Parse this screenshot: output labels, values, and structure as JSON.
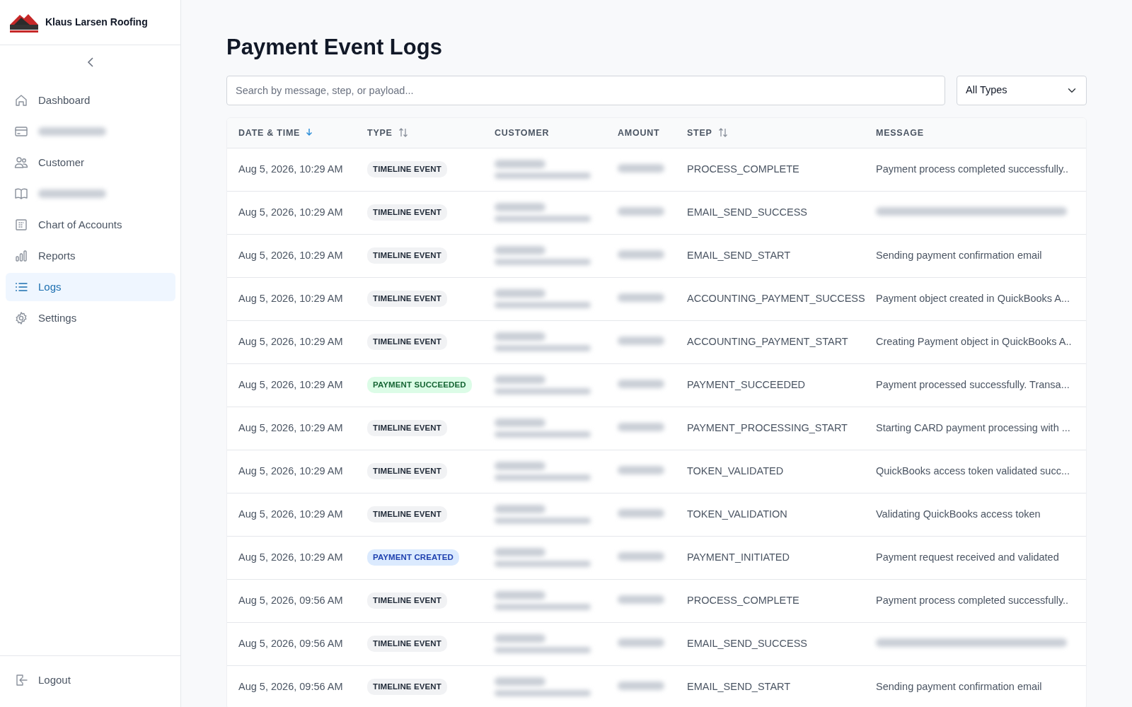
{
  "brand": {
    "name": "Klaus Larsen Roofing"
  },
  "sidebar": {
    "items": [
      {
        "label": "Dashboard",
        "blurred": false,
        "selected": false
      },
      {
        "blurred": true,
        "selected": false
      },
      {
        "label": "Customer",
        "blurred": false,
        "selected": false
      },
      {
        "blurred": true,
        "selected": false
      },
      {
        "label": "Chart of Accounts",
        "blurred": false,
        "selected": false
      },
      {
        "label": "Reports",
        "blurred": false,
        "selected": false
      },
      {
        "label": "Logs",
        "blurred": false,
        "selected": true
      },
      {
        "label": "Settings",
        "blurred": false,
        "selected": false
      }
    ],
    "logout": "Logout"
  },
  "page": {
    "title": "Payment Event Logs"
  },
  "search": {
    "placeholder": "Search by message, step, or payload..."
  },
  "type_filter": {
    "value": "All Types"
  },
  "table": {
    "columns": [
      {
        "label": "DATE & TIME",
        "sortable": true,
        "sorted": true
      },
      {
        "label": "TYPE",
        "sortable": true,
        "sorted": false
      },
      {
        "label": "CUSTOMER",
        "sortable": false
      },
      {
        "label": "AMOUNT",
        "sortable": false
      },
      {
        "label": "STEP",
        "sortable": true,
        "sorted": false
      },
      {
        "label": "MESSAGE",
        "sortable": false
      }
    ],
    "rows": [
      {
        "date": "Aug 5, 2026, 10:29 AM",
        "type": {
          "kind": "timeline",
          "label": "TIMELINE EVENT"
        },
        "step": "PROCESS_COMPLETE",
        "message": "Payment process completed successfully.."
      },
      {
        "date": "Aug 5, 2026, 10:29 AM",
        "type": {
          "kind": "timeline",
          "label": "TIMELINE EVENT"
        },
        "step": "EMAIL_SEND_SUCCESS",
        "message_blurred": true
      },
      {
        "date": "Aug 5, 2026, 10:29 AM",
        "type": {
          "kind": "timeline",
          "label": "TIMELINE EVENT"
        },
        "step": "EMAIL_SEND_START",
        "message": "Sending payment confirmation email"
      },
      {
        "date": "Aug 5, 2026, 10:29 AM",
        "type": {
          "kind": "timeline",
          "label": "TIMELINE EVENT"
        },
        "step": "ACCOUNTING_PAYMENT_SUCCESS",
        "message": "Payment object created in QuickBooks A..."
      },
      {
        "date": "Aug 5, 2026, 10:29 AM",
        "type": {
          "kind": "timeline",
          "label": "TIMELINE EVENT"
        },
        "step": "ACCOUNTING_PAYMENT_START",
        "message": "Creating Payment object in QuickBooks A.."
      },
      {
        "date": "Aug 5, 2026, 10:29 AM",
        "type": {
          "kind": "succeeded",
          "label": "PAYMENT SUCCEEDED"
        },
        "step": "PAYMENT_SUCCEEDED",
        "message": "Payment processed successfully. Transa..."
      },
      {
        "date": "Aug 5, 2026, 10:29 AM",
        "type": {
          "kind": "timeline",
          "label": "TIMELINE EVENT"
        },
        "step": "PAYMENT_PROCESSING_START",
        "message": "Starting CARD payment processing with ..."
      },
      {
        "date": "Aug 5, 2026, 10:29 AM",
        "type": {
          "kind": "timeline",
          "label": "TIMELINE EVENT"
        },
        "step": "TOKEN_VALIDATED",
        "message": "QuickBooks access token validated succ..."
      },
      {
        "date": "Aug 5, 2026, 10:29 AM",
        "type": {
          "kind": "timeline",
          "label": "TIMELINE EVENT"
        },
        "step": "TOKEN_VALIDATION",
        "message": "Validating QuickBooks access token"
      },
      {
        "date": "Aug 5, 2026, 10:29 AM",
        "type": {
          "kind": "created",
          "label": "PAYMENT CREATED"
        },
        "step": "PAYMENT_INITIATED",
        "message": "Payment request received and validated"
      },
      {
        "date": "Aug 5, 2026, 09:56 AM",
        "type": {
          "kind": "timeline",
          "label": "TIMELINE EVENT"
        },
        "step": "PROCESS_COMPLETE",
        "message": "Payment process completed successfully.."
      },
      {
        "date": "Aug 5, 2026, 09:56 AM",
        "type": {
          "kind": "timeline",
          "label": "TIMELINE EVENT"
        },
        "step": "EMAIL_SEND_SUCCESS",
        "message_blurred": true
      },
      {
        "date": "Aug 5, 2026, 09:56 AM",
        "type": {
          "kind": "timeline",
          "label": "TIMELINE EVENT"
        },
        "step": "EMAIL_SEND_START",
        "message": "Sending payment confirmation email"
      }
    ]
  }
}
